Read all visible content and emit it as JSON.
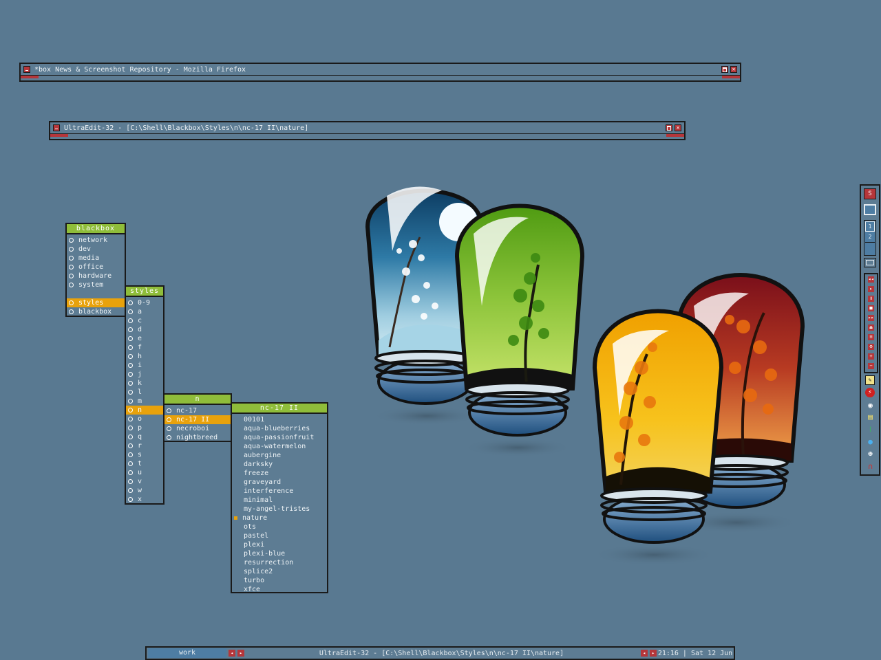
{
  "windows": {
    "firefox": {
      "title": "*box News & Screenshot Repository - Mozilla Firefox"
    },
    "ultraedit": {
      "title": "UltraEdit-32 - [C:\\Shell\\Blackbox\\Styles\\n\\nc-17 II\\nature]"
    }
  },
  "menus": {
    "root": {
      "title": "blackbox",
      "items": [
        "network",
        "dev",
        "media",
        "office",
        "hardware",
        "system",
        "",
        "styles",
        "blackbox"
      ],
      "selected": "styles"
    },
    "styles": {
      "title": "styles",
      "items": [
        "0-9",
        "a",
        "c",
        "d",
        "e",
        "f",
        "h",
        "i",
        "j",
        "k",
        "l",
        "m",
        "n",
        "o",
        "p",
        "q",
        "r",
        "s",
        "t",
        "u",
        "v",
        "w",
        "x"
      ],
      "selected": "n"
    },
    "n": {
      "title": "n",
      "items": [
        "nc-17",
        "nc-17 II",
        "necroboi",
        "nightbreed"
      ],
      "selected": "nc-17 II"
    },
    "nc17ii": {
      "title": "nc-17 II",
      "items": [
        "00101",
        "aqua-blueberries",
        "aqua-passionfruit",
        "aqua-watermelon",
        "aubergine",
        "darksky",
        "freeze",
        "graveyard",
        "interference",
        "minimal",
        "my-angel-tristes",
        "nature",
        "ots",
        "pastel",
        "plexi",
        "plexi-blue",
        "resurrection",
        "splice2",
        "turbo",
        "xfce"
      ],
      "current": "nature"
    }
  },
  "slit": {
    "workspace_numbers": [
      "1",
      "2"
    ],
    "media_controls": [
      "rewind-icon",
      "play-icon",
      "pause-icon",
      "stop-icon",
      "fast-forward-icon",
      "eject-icon",
      "playlist-icon",
      "settings-icon",
      "volume-up-icon",
      "volume-down-icon"
    ],
    "tray_icons": [
      "notepad-icon",
      "antivirus-icon",
      "network-icon",
      "sticky-notes-icon",
      "traffic-light-icon",
      "globe-icon",
      "alien-icon",
      "magnet-icon"
    ]
  },
  "toolbar": {
    "workspace": "work",
    "window_title": "UltraEdit-32 - [C:\\Shell\\Blackbox\\Styles\\n\\nc-17 II\\nature]",
    "clock": "21:16 | Sat 12 Jun"
  },
  "colors": {
    "desktop": "#597991",
    "accent_red": "#b5363a",
    "menu_title_green": "#8fbd3a",
    "selection_orange": "#e8a20c",
    "border": "#1a1a1a"
  }
}
